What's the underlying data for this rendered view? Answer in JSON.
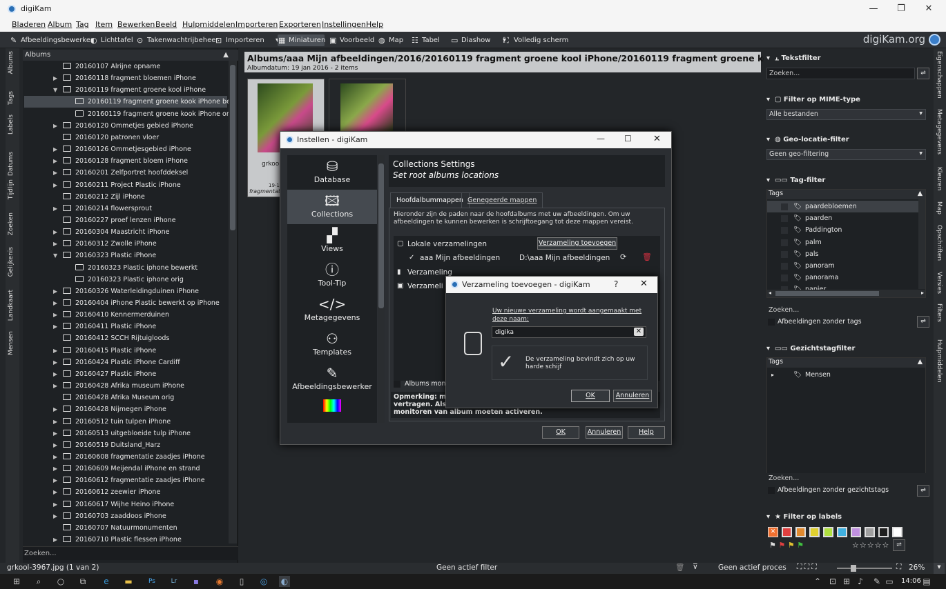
{
  "app": {
    "title": "digiKam"
  },
  "menu": [
    "Bladeren",
    "Album",
    "Tag",
    "Item",
    "Bewerken",
    "Beeld",
    "Hulpmiddelen",
    "Importeren",
    "Exporteren",
    "Instellingen",
    "Help"
  ],
  "toolbar": {
    "items": [
      "Afbeeldingsbewerker",
      "Lichttafel",
      "Takenwachtrijbeheer",
      "Importeren",
      "Miniaturen",
      "Voorbeeld",
      "Map",
      "Tabel",
      "Diashow",
      "Volledig scherm"
    ],
    "brand": "digiKam.org"
  },
  "lefttabs": [
    "Albums",
    "Tags",
    "Labels",
    "Datums",
    "Tijdlijn",
    "Zoeken",
    "Gelijkenis",
    "Landkaart",
    "Mensen"
  ],
  "albums": {
    "header": "Albums",
    "search_placeholder": "Zoeken...",
    "items": [
      {
        "label": "20160107 Alrijne opname",
        "level": 0,
        "arrow": false
      },
      {
        "label": "20160118 fragment bloemen iPhone",
        "level": 0,
        "arrow": true
      },
      {
        "label": "20160119 fragment groene kool iPhone",
        "level": 0,
        "arrow": true,
        "open": true
      },
      {
        "label": "20160119 fragment groene kook iPhone bewerkt",
        "level": 1,
        "arrow": false,
        "selected": true
      },
      {
        "label": "20160119 fragment groene kook iPhone orig",
        "level": 1,
        "arrow": false
      },
      {
        "label": "20160120 Ommetjes gebied iPhone",
        "level": 0,
        "arrow": true
      },
      {
        "label": "20160120 patronen vloer",
        "level": 0,
        "arrow": false
      },
      {
        "label": "20160126 Ommetjesgebied iPhone",
        "level": 0,
        "arrow": true
      },
      {
        "label": "20160128 fragment bloem iPhone",
        "level": 0,
        "arrow": true
      },
      {
        "label": "20160201 Zelfportret hoofddeksel",
        "level": 0,
        "arrow": true
      },
      {
        "label": "20160211 Project Plastic iPhone",
        "level": 0,
        "arrow": true
      },
      {
        "label": "20160212 Zijl iPhone",
        "level": 0,
        "arrow": false
      },
      {
        "label": "20160214 flowersprout",
        "level": 0,
        "arrow": true
      },
      {
        "label": "20160227 proef lenzen iPhone",
        "level": 0,
        "arrow": false
      },
      {
        "label": "20160304 Maastricht iPhone",
        "level": 0,
        "arrow": true
      },
      {
        "label": "20160312 Zwolle iPhone",
        "level": 0,
        "arrow": true
      },
      {
        "label": "20160323 Plastic iPhone",
        "level": 0,
        "arrow": true,
        "open": true
      },
      {
        "label": "20160323 Plastic iphone bewerkt",
        "level": 1,
        "arrow": false
      },
      {
        "label": "20160323 Plastic iphone orig",
        "level": 1,
        "arrow": false
      },
      {
        "label": "20160326 Waterleidingduinen iPhone",
        "level": 0,
        "arrow": true
      },
      {
        "label": "20160404 iPhone Plastic bewerkt op iPhone",
        "level": 0,
        "arrow": true
      },
      {
        "label": "20160410 Kennermerduinen",
        "level": 0,
        "arrow": true
      },
      {
        "label": "20160411 Plastic iPhone",
        "level": 0,
        "arrow": true
      },
      {
        "label": "20160412 SCCH Rijtuigloods",
        "level": 0,
        "arrow": false
      },
      {
        "label": "20160415 Plastic iPhone",
        "level": 0,
        "arrow": true
      },
      {
        "label": "20160424 Plastic iPhone Cardiff",
        "level": 0,
        "arrow": true
      },
      {
        "label": "20160427 Plastic iPhone",
        "level": 0,
        "arrow": true
      },
      {
        "label": "20160428 Afrika museum iPhone",
        "level": 0,
        "arrow": true
      },
      {
        "label": "20160428 Afrika Museum orig",
        "level": 0,
        "arrow": false
      },
      {
        "label": "20160428 Nijmegen iPhone",
        "level": 0,
        "arrow": true
      },
      {
        "label": "20160512 tuin tulpen iPhone",
        "level": 0,
        "arrow": true
      },
      {
        "label": "20160513 uitgebloeide tulp iPhone",
        "level": 0,
        "arrow": true
      },
      {
        "label": "20160519 Duitsland_Harz",
        "level": 0,
        "arrow": true
      },
      {
        "label": "20160608 fragmentatie zaadjes iPhone",
        "level": 0,
        "arrow": true
      },
      {
        "label": "20160609 Meijendal iPhone en strand",
        "level": 0,
        "arrow": true
      },
      {
        "label": "20160612 fragmentatie zaadjes iPhone",
        "level": 0,
        "arrow": true
      },
      {
        "label": "20160612 zeewier iPhone",
        "level": 0,
        "arrow": true
      },
      {
        "label": "20160617 Wijhe Heino iPhone",
        "level": 0,
        "arrow": true
      },
      {
        "label": "20160703 zaaddoos iPhone",
        "level": 0,
        "arrow": true
      },
      {
        "label": "20160707 Natuurmonumenten",
        "level": 0,
        "arrow": false
      },
      {
        "label": "20160710 Plastic flessen iPhone",
        "level": 0,
        "arrow": true
      }
    ]
  },
  "center": {
    "path": "Albums/aaa Mijn afbeeldingen/2016/20160119 fragment groene kool iPhone/20160119 fragment groene kook iPhone...",
    "subtitle": "Albumdatum: 19 jan 2016 - 2 items",
    "thumb1_name": "grkool-",
    "thumb1_date": "19-1-",
    "thumb1_tag": "fragmentat"
  },
  "right": {
    "text_filter": {
      "title": "Tekstfilter",
      "placeholder": "Zoeken..."
    },
    "mime": {
      "title": "Filter op MIME-type",
      "value": "Alle bestanden"
    },
    "geo": {
      "title": "Geo-locatie-filter",
      "value": "Geen geo-filtering"
    },
    "tag": {
      "title": "Tag-filter",
      "col": "Tags",
      "items": [
        "paardebloemen",
        "paarden",
        "Paddington",
        "palm",
        "pals",
        "panoram",
        "panorama",
        "papier"
      ],
      "search": "Zoeken...",
      "untagged": "Afbeeldingen zonder tags"
    },
    "face": {
      "title": "Gezichtstagfilter",
      "col": "Tags",
      "items": [
        "Mensen"
      ],
      "search": "Zoeken...",
      "untagged": "Afbeeldingen zonder gezichtstags"
    },
    "labels": {
      "title": "Filter op labels",
      "colors": [
        "#e04040",
        "#e08a30",
        "#e0d030",
        "#b0e040",
        "#40b0e0",
        "#c090e0",
        "#a0a0a0",
        "#202020",
        "#ffffff"
      ]
    }
  },
  "righttabs": [
    "Eigenschappen",
    "Metagegevens",
    "Kleuren",
    "Map",
    "Opschriften",
    "Versies",
    "Filters",
    "Hulpmiddelen"
  ],
  "status": {
    "file": "grkool-3967.jpg (1 van 2)",
    "filter": "Geen actief filter",
    "process": "Geen actief proces",
    "zoom": "26%"
  },
  "taskbar": {
    "time": "14:06"
  },
  "settings": {
    "title": "Instellen - digiKam",
    "nav": [
      "Database",
      "Collections",
      "Views",
      "Tool-Tip",
      "Metagegevens",
      "Templates",
      "Afbeeldingsbewerker"
    ],
    "head": "Collections Settings",
    "subhead": "Set root albums locations",
    "tabs": [
      "Hoofdalbummappen",
      "Genegeerde mappen"
    ],
    "desc": "Hieronder zijn de paden naar de hoofdalbums met uw afbeeldingen. Om uw afbeeldingen te kunnen bewerken is schrijftoegang tot deze mappen vereist.",
    "local": "Lokale verzamelingen",
    "add_btn": "Verzameling toevoegen",
    "coll_name": "aaa Mijn afbeeldingen",
    "coll_path": "D:\\aaa Mijn afbeeldingen",
    "cut1": "Verzameling",
    "cut2": "Verzameli",
    "monitor": "Albums monito",
    "note1": "Opmerking: mon",
    "note2": "vertragen. Als",
    "note3": "monitoren van album moeten activeren.",
    "ok": "OK",
    "cancel": "Annuleren",
    "help": "Help"
  },
  "addcoll": {
    "title": "Verzameling toevoegen - digiKam",
    "q": "?",
    "label": "Uw nieuwe verzameling wordt aangemaakt met deze naam:",
    "value": "digika",
    "info": "De verzameling bevindt zich op uw harde schijf",
    "ok": "OK",
    "cancel": "Annuleren"
  }
}
